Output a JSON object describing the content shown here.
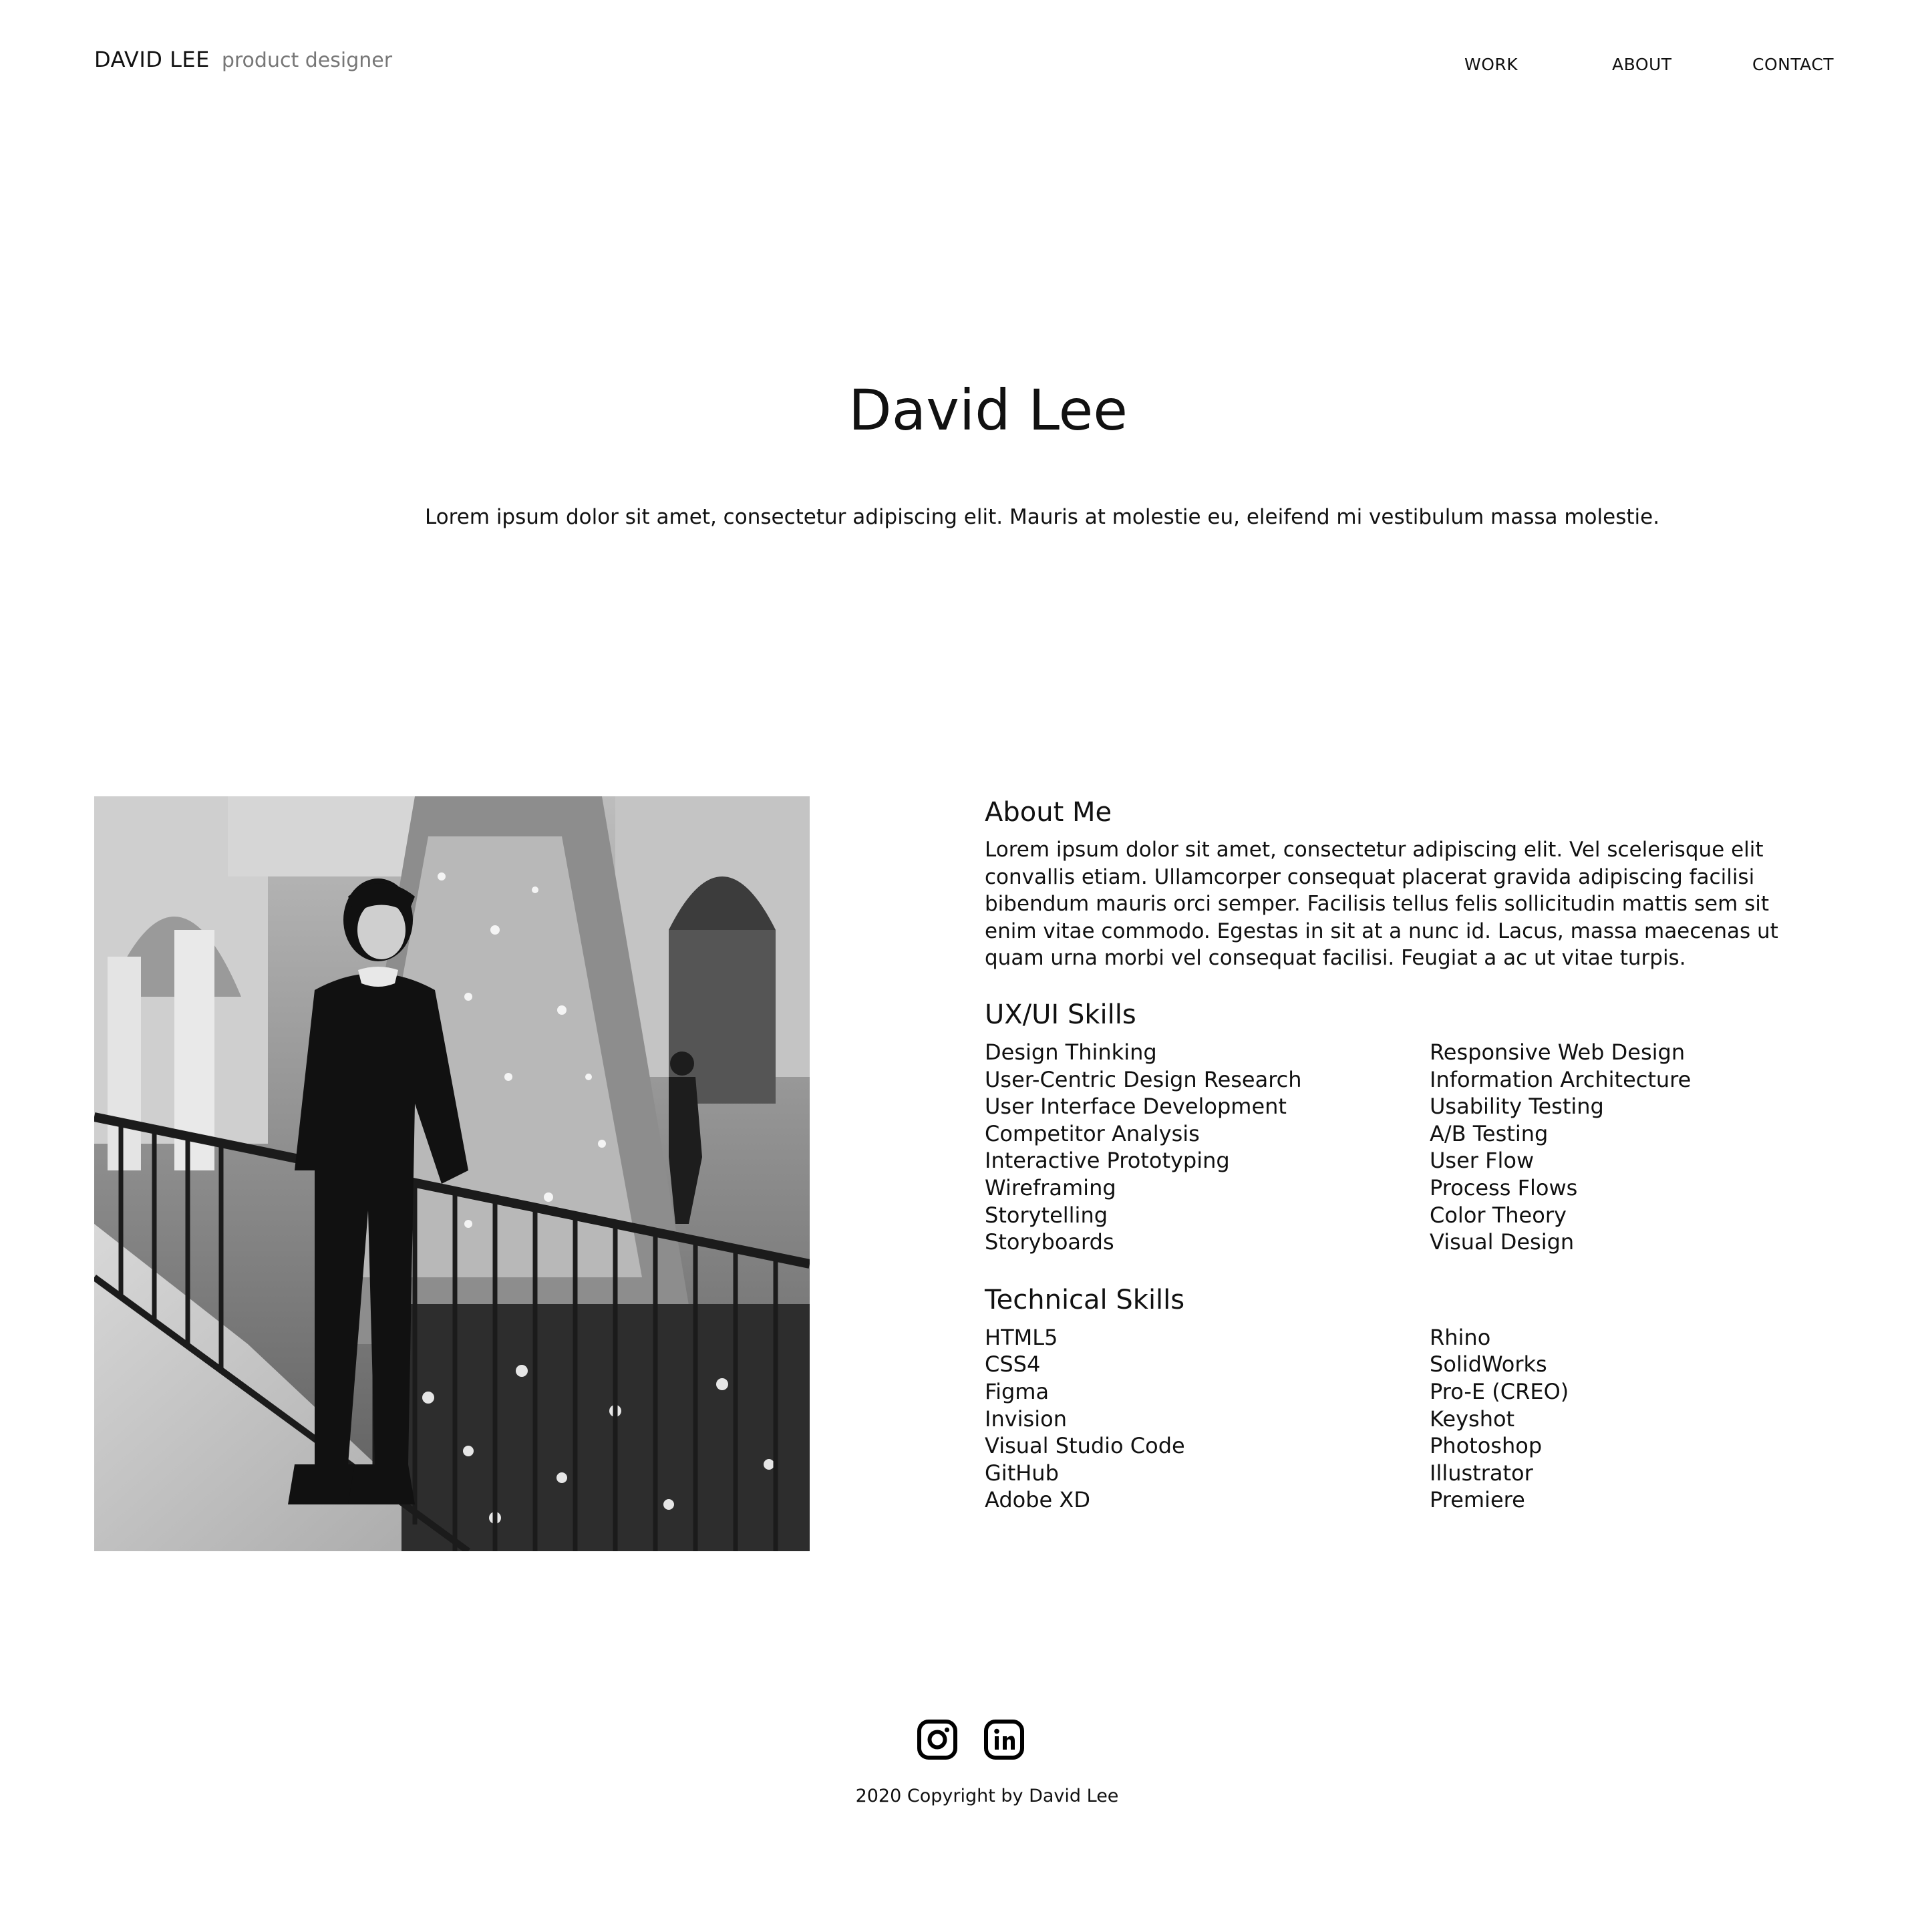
{
  "header": {
    "brand_name": "DAVID LEE",
    "brand_role": "product designer",
    "nav": [
      "WORK",
      "ABOUT",
      "CONTACT"
    ]
  },
  "hero": {
    "title": "David Lee",
    "subtitle": "Lorem ipsum dolor sit amet, consectetur adipiscing elit. Mauris at molestie eu, eleifend mi vestibulum massa molestie."
  },
  "about": {
    "heading": "About Me",
    "text": "Lorem ipsum dolor sit amet, consectetur adipiscing elit. Vel scelerisque elit convallis etiam. Ullamcorper consequat placerat gravida adipiscing facilisi bibendum mauris orci semper. Facilisis tellus felis sollicitudin mattis sem sit enim vitae commodo. Egestas in sit at a nunc id. Lacus, massa maecenas ut quam urna morbi vel consequat facilisi. Feugiat a ac ut vitae turpis."
  },
  "ux_skills": {
    "heading": "UX/UI Skills",
    "left": [
      "Design Thinking",
      "User-Centric Design Research",
      "User Interface Development",
      "Competitor Analysis",
      "Interactive Prototyping",
      "Wireframing",
      "Storytelling",
      "Storyboards"
    ],
    "right": [
      "Responsive Web Design",
      "Information Architecture",
      "Usability Testing",
      "A/B Testing",
      "User Flow",
      "Process Flows",
      "Color Theory",
      "Visual Design"
    ]
  },
  "tech_skills": {
    "heading": "Technical Skills",
    "left": [
      "HTML5",
      "CSS4",
      "Figma",
      "Invision",
      "Visual Studio Code",
      "GitHub",
      "Adobe XD"
    ],
    "right": [
      "Rhino",
      "SolidWorks",
      "Pro-E (CREO)",
      "Keyshot",
      "Photoshop",
      "Illustrator",
      "Premiere"
    ]
  },
  "footer": {
    "icons": [
      "instagram-icon",
      "linkedin-icon"
    ],
    "copyright": "2020 Copyright by David Lee"
  }
}
